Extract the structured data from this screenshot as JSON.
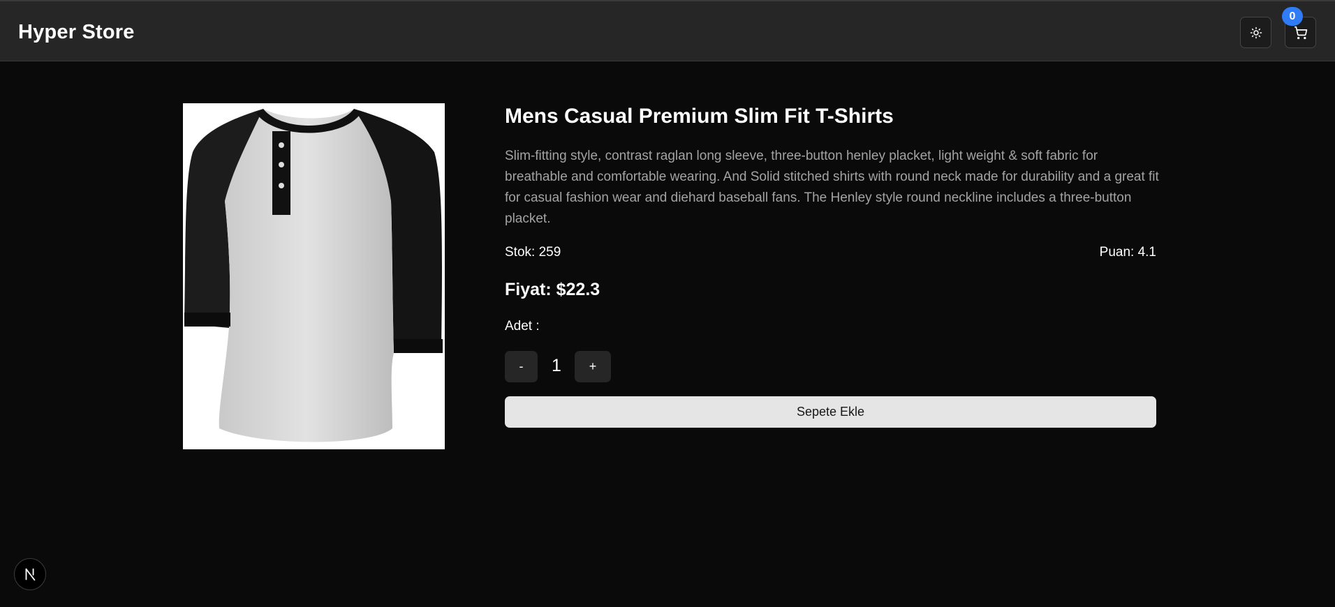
{
  "header": {
    "brand": "Hyper Store",
    "theme_icon": "sun-icon",
    "cart_icon": "cart-icon",
    "cart_count": "0"
  },
  "product": {
    "title": "Mens Casual Premium Slim Fit T-Shirts",
    "description": "Slim-fitting style, contrast raglan long sleeve, three-button henley placket, light weight & soft fabric for breathable and comfortable wearing. And Solid stitched shirts with round neck made for durability and a great fit for casual fashion wear and diehard baseball fans. The Henley style round neckline includes a three-button placket.",
    "stock": "Stok: 259",
    "rating": "Puan: 4.1",
    "price": "Fiyat: $22.3",
    "quantity_label": "Adet :",
    "quantity_value": "1",
    "minus_label": "-",
    "plus_label": "+",
    "add_to_cart_label": "Sepete Ekle",
    "image_icon": "henley-shirt-image"
  },
  "dev_indicator": {
    "icon": "nextjs-logo-icon"
  },
  "colors": {
    "background": "#0a0a0a",
    "header": "#262626",
    "accent_badge": "#2f7cf6",
    "primary_button": "#e5e5e5",
    "muted_text": "#a3a3a3"
  }
}
